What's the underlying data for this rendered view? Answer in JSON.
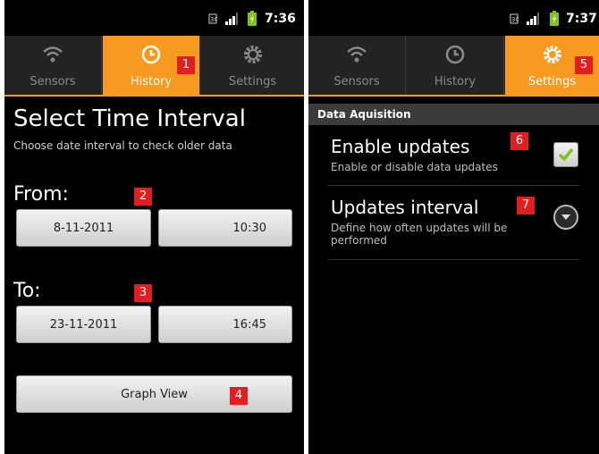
{
  "left": {
    "status": {
      "time": "7:36"
    },
    "tabs": [
      {
        "label": "Sensors",
        "icon": "wifi-icon",
        "active": false
      },
      {
        "label": "History",
        "icon": "clock-icon",
        "active": true
      },
      {
        "label": "Settings",
        "icon": "gear-icon",
        "active": false
      }
    ],
    "title": "Select Time Interval",
    "subtitle": "Choose date interval to check older data",
    "from": {
      "label": "From:",
      "date": "8-11-2011",
      "time": "10:30"
    },
    "to": {
      "label": "To:",
      "date": "23-11-2011",
      "time": "16:45"
    },
    "graph_button": "Graph View",
    "badges": [
      "1",
      "2",
      "3",
      "4"
    ]
  },
  "right": {
    "status": {
      "time": "7:37"
    },
    "tabs": [
      {
        "label": "Sensors",
        "icon": "wifi-icon",
        "active": false
      },
      {
        "label": "History",
        "icon": "clock-icon",
        "active": false
      },
      {
        "label": "Settings",
        "icon": "gear-icon",
        "active": true
      }
    ],
    "section_header": "Data Aquisition",
    "prefs": [
      {
        "title": "Enable updates",
        "summary": "Enable or disable data updates",
        "checked": true
      },
      {
        "title": "Updates interval",
        "summary": "Define how often updates will be performed"
      }
    ],
    "badges": [
      "5",
      "6",
      "7"
    ]
  },
  "colors": {
    "accent": "#f79a1f",
    "badge": "#e02020",
    "background": "#000000",
    "check": "#7fc31c"
  }
}
